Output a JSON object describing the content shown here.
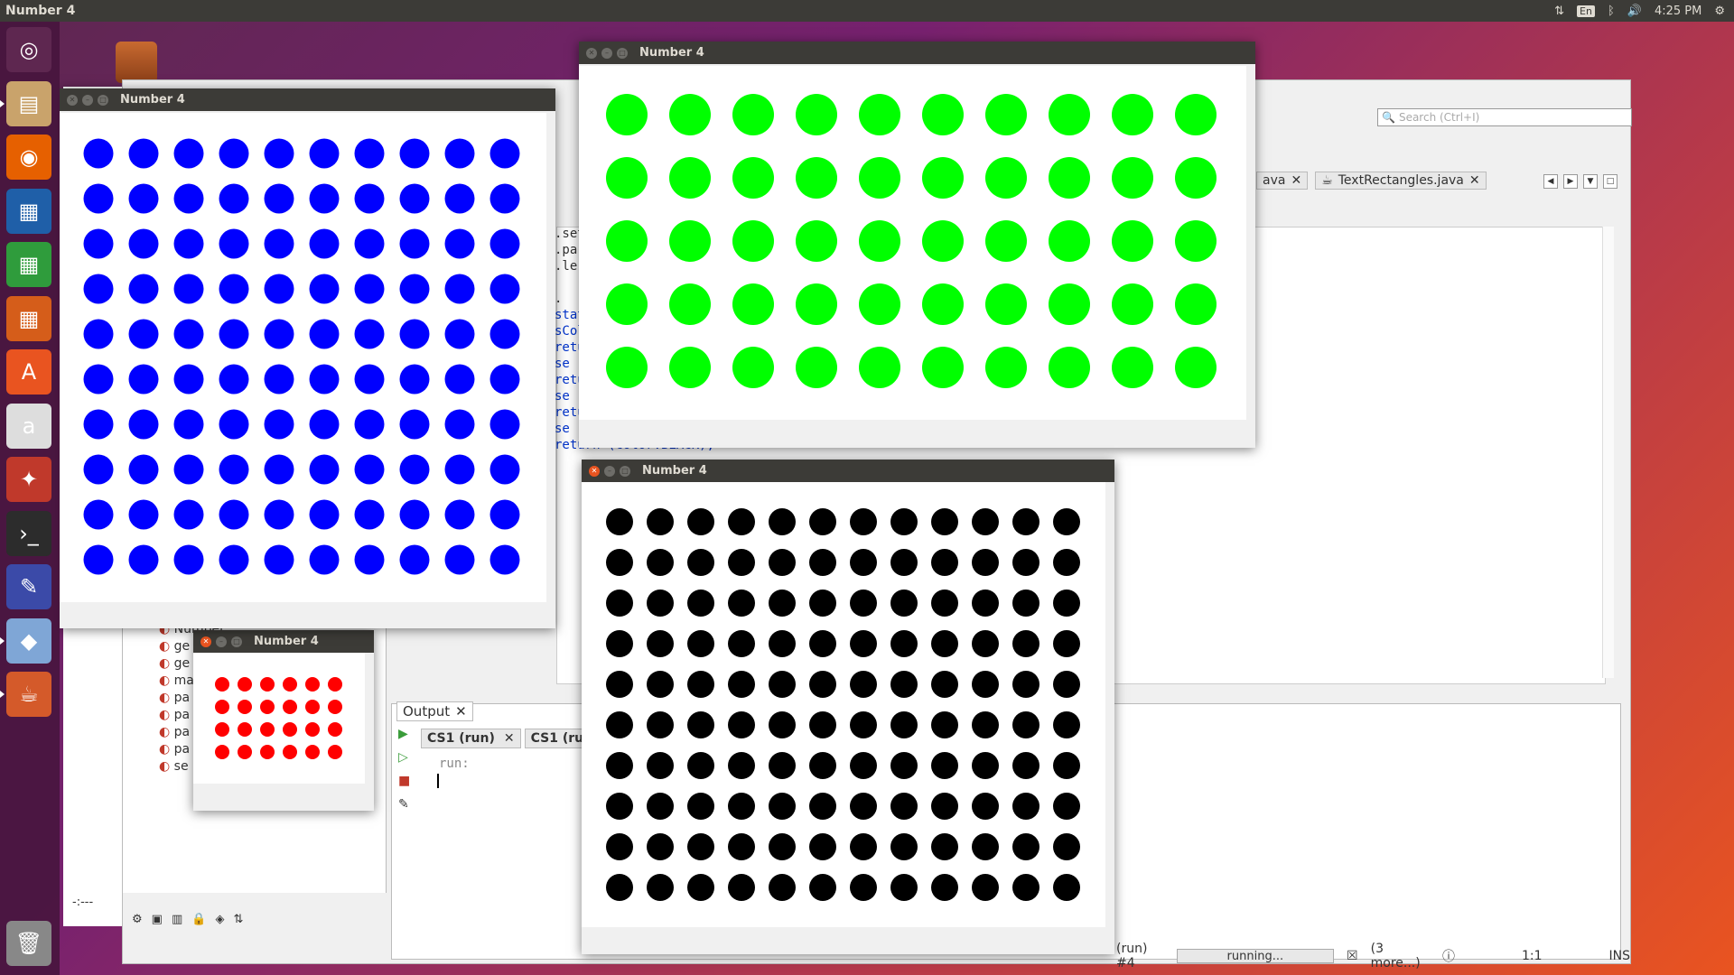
{
  "topbar": {
    "title": "Number 4",
    "lang": "En",
    "time": "4:25 PM"
  },
  "launcher": {
    "items": [
      {
        "name": "ubuntu-dash-icon",
        "glyph": "◎",
        "color": "#5e2750",
        "pip": false
      },
      {
        "name": "files-icon",
        "glyph": "▤",
        "color": "#c9a36b",
        "pip": true
      },
      {
        "name": "firefox-icon",
        "glyph": "◉",
        "color": "#e66000",
        "pip": false
      },
      {
        "name": "libreoffice-writer-icon",
        "glyph": "▦",
        "color": "#1f5fa8",
        "pip": false
      },
      {
        "name": "libreoffice-calc-icon",
        "glyph": "▦",
        "color": "#2f9c3c",
        "pip": false
      },
      {
        "name": "libreoffice-impress-icon",
        "glyph": "▦",
        "color": "#d55d1a",
        "pip": false
      },
      {
        "name": "software-center-icon",
        "glyph": "A",
        "color": "#e95420",
        "pip": false
      },
      {
        "name": "amazon-icon",
        "glyph": "a",
        "color": "#dddddd",
        "pip": false
      },
      {
        "name": "system-settings-icon",
        "glyph": "✦",
        "color": "#c0392b",
        "pip": false
      },
      {
        "name": "terminal-icon",
        "glyph": "›_",
        "color": "#2c2c2c",
        "pip": false
      },
      {
        "name": "code-editor-icon",
        "glyph": "✎",
        "color": "#3b4aa8",
        "pip": false
      },
      {
        "name": "virtualbox-icon",
        "glyph": "◆",
        "color": "#7fa6d6",
        "pip": true
      },
      {
        "name": "java-icon",
        "glyph": "☕",
        "color": "#d45a2a",
        "pip": true
      }
    ]
  },
  "ide": {
    "search_placeholder": "Search (Ctrl+I)",
    "tabs": [
      {
        "label": "ava"
      },
      {
        "label": "TextRectangles.java"
      }
    ],
    "code_lines": [
      ".set",
      ".pa",
      ".le.",
      ".",
      "stat",
      "sCol",
      "retu",
      "se (",
      "retu",
      "se (",
      "retu",
      "se",
      "return (Color.BLACK);"
    ],
    "output_tab": "Output",
    "run_tabs": [
      {
        "label": "CS1 (run)"
      },
      {
        "label": "CS1 (run) #"
      }
    ],
    "run_text": "run:",
    "tree_items": [
      "Number...",
      "ge",
      "ge",
      "ma",
      "pa",
      "pa",
      "pa",
      "pa",
      "se"
    ],
    "status": {
      "run_label": "(run) #4",
      "progress_text": "running...",
      "more": "(3 more...)",
      "position": "1:1",
      "mode": "INS"
    },
    "minus_line": "-:---"
  },
  "windows": {
    "blue": {
      "title": "Number 4",
      "color": "#0000ff",
      "rows": 10,
      "cols": 10
    },
    "green": {
      "title": "Number 4",
      "color": "#00ff00",
      "rows": 5,
      "cols": 10
    },
    "black": {
      "title": "Number 4",
      "color": "#000000",
      "rows": 10,
      "cols": 12
    },
    "red": {
      "title": "Number 4",
      "color": "#ff0000",
      "rows": 4,
      "cols": 6
    }
  }
}
